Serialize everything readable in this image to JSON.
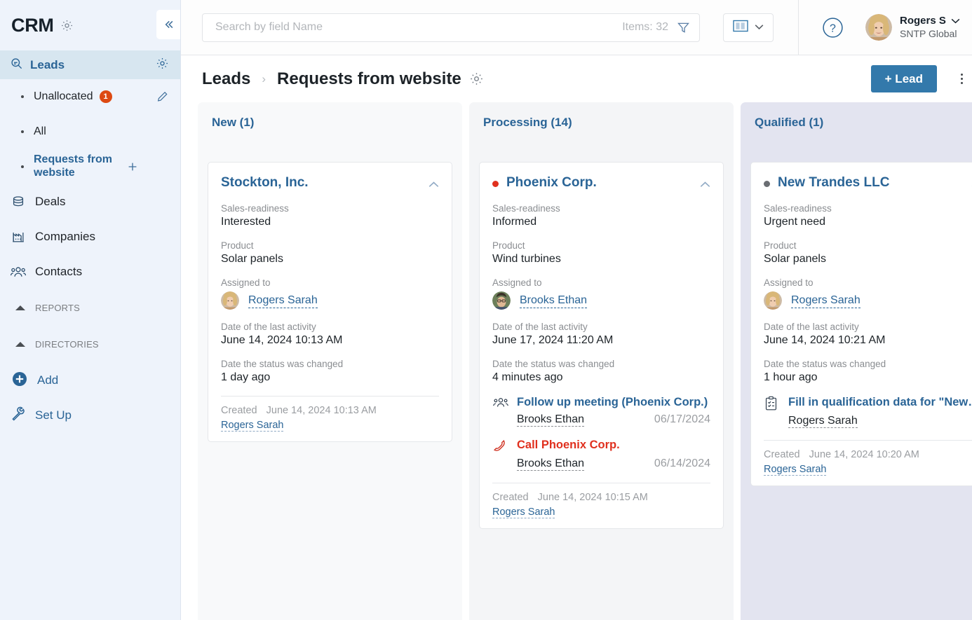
{
  "brand": {
    "title": "CRM",
    "gear_icon": "gear-icon",
    "collapse_icon": "chevron-double-left-icon"
  },
  "sidebar": {
    "active_section": {
      "label": "Leads",
      "icon": "leads-search-icon",
      "gear_icon": "gear-icon"
    },
    "sub_items": [
      {
        "label": "Unallocated",
        "badge": "1",
        "right_icon": "pencil-icon"
      },
      {
        "label": "All",
        "badge": "",
        "right_icon": ""
      },
      {
        "label": "Requests from website",
        "badge": "",
        "right_icon": "plus-icon"
      }
    ],
    "main_items": [
      {
        "label": "Deals",
        "icon": "coins-stack-icon"
      },
      {
        "label": "Companies",
        "icon": "factory-icon"
      },
      {
        "label": "Contacts",
        "icon": "people-icon"
      }
    ],
    "sections": [
      {
        "label": "REPORTS",
        "icon": "triangle-up-icon"
      },
      {
        "label": "DIRECTORIES",
        "icon": "triangle-up-icon"
      }
    ],
    "add": {
      "label": "Add",
      "icon": "plus-circle-icon"
    },
    "setup": {
      "label": "Set Up",
      "icon": "wrench-icon"
    }
  },
  "topbar": {
    "search_placeholder": "Search by field Name",
    "search_value": "",
    "items_count": "Items: 32",
    "funnel_icon": "funnel-filter-icon",
    "view_icon": "columns-view-icon",
    "view_chevron": "chevron-down-icon",
    "help_icon": "question-mark-circle-icon",
    "user": {
      "name": "Rogers S",
      "org": "SNTP Global",
      "chevron": "chevron-down-icon",
      "avatar": "user-avatar"
    }
  },
  "page": {
    "breadcrumb_root": "Leads",
    "breadcrumb_separator": "›",
    "breadcrumb_leaf": "Requests from website",
    "title_gear_icon": "gear-icon",
    "add_lead_label": "+ Lead",
    "kebab_icon": "more-vertical-icon",
    "settings_icon": "gear-icon",
    "accent_color": "#3379ab"
  },
  "labels": {
    "sales_readiness": "Sales-readiness",
    "product": "Product",
    "assigned_to": "Assigned to",
    "last_activity": "Date of the last activity",
    "status_changed": "Date the status was changed",
    "created": "Created"
  },
  "board": {
    "columns": [
      {
        "title": "New (1)",
        "bg": "#f8f9fa",
        "cards": [
          {
            "name": "Stockton, Inc.",
            "dot_color": "",
            "sales_readiness": "Interested",
            "product": "Solar panels",
            "assignee": "Rogers Sarah",
            "assignee_avatar": "female-avatar",
            "last_activity": "June 14, 2024 10:13 AM",
            "status_changed": "1 day ago",
            "activities": [],
            "created_date": "June 14, 2024 10:13 AM",
            "created_by": "Rogers Sarah"
          }
        ]
      },
      {
        "title": "Processing (14)",
        "bg": "#f4f5f7",
        "cards": [
          {
            "name": "Phoenix Corp.",
            "dot_color": "#e0301e",
            "sales_readiness": "Informed",
            "product": "Wind turbines",
            "assignee": "Brooks Ethan",
            "assignee_avatar": "male-avatar",
            "last_activity": "June 17, 2024 11:20 AM",
            "status_changed": "4 minutes ago",
            "activities": [
              {
                "icon": "meeting-people-icon",
                "title": "Follow up meeting (Phoenix Corp.)",
                "overdue": false,
                "person": "Brooks Ethan",
                "date": "06/17/2024"
              },
              {
                "icon": "phone-call-icon",
                "title": "Call Phoenix Corp.",
                "overdue": true,
                "person": "Brooks Ethan",
                "date": "06/14/2024"
              }
            ],
            "created_date": "June 14, 2024 10:15 AM",
            "created_by": "Rogers Sarah"
          }
        ]
      },
      {
        "title": "Qualified (1)",
        "bg": "#e3e4f0",
        "cards": [
          {
            "name": "New Trandes LLC",
            "dot_color": "#6a6d72",
            "sales_readiness": "Urgent need",
            "product": "Solar panels",
            "assignee": "Rogers Sarah",
            "assignee_avatar": "female-avatar",
            "last_activity": "June 14, 2024 10:21 AM",
            "status_changed": "1 hour ago",
            "activities": [
              {
                "icon": "clipboard-task-icon",
                "title": "Fill in qualification data for \"New Tra...",
                "overdue": false,
                "person": "Rogers Sarah",
                "date": ""
              }
            ],
            "created_date": "June 14, 2024 10:20 AM",
            "created_by": "Rogers Sarah"
          }
        ]
      }
    ]
  }
}
